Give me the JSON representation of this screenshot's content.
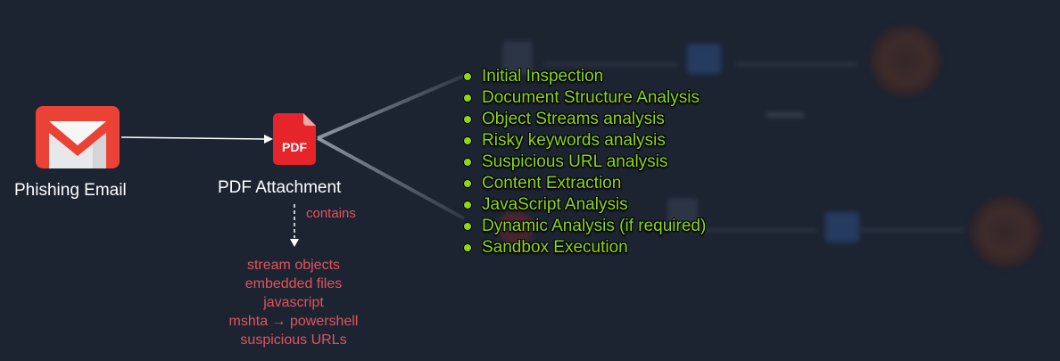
{
  "diagram": {
    "source": {
      "label": "Phishing Email",
      "icon": "gmail-icon"
    },
    "attachment": {
      "label": "PDF Attachment",
      "icon": "pdf-file-icon",
      "badge": "PDF"
    },
    "relation_label": "contains",
    "contents": [
      "stream objects",
      "embedded files",
      "javascript",
      "mshta → powershell",
      "suspicious URLs"
    ],
    "analysis_steps": [
      "Initial Inspection",
      "Document Structure Analysis",
      "Object Streams analysis",
      "Risky keywords analysis",
      "Suspicious URL analysis",
      "Content Extraction",
      "JavaScript Analysis",
      "Dynamic Analysis (if required)",
      "Sandbox Execution"
    ],
    "colors": {
      "background": "#1c2331",
      "accent_green": "#8fd61b",
      "accent_red": "#e2545f",
      "gmail_red": "#ea4335",
      "pdf_red": "#e5252a"
    }
  }
}
